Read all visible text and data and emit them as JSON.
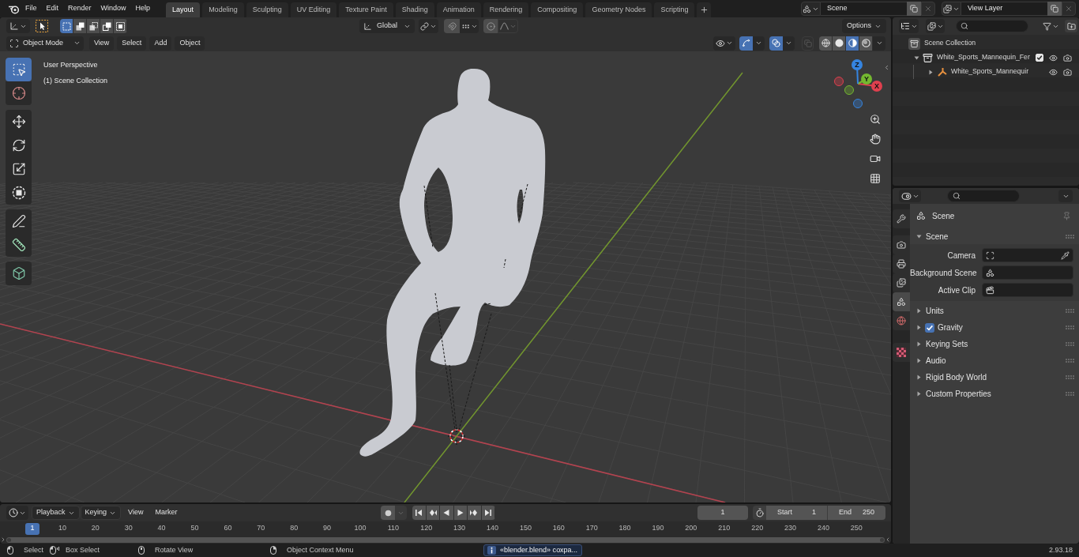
{
  "top_bar": {
    "menus": [
      "File",
      "Edit",
      "Render",
      "Window",
      "Help"
    ],
    "workspaces": [
      {
        "label": "Layout",
        "selected": true
      },
      {
        "label": "Modeling",
        "selected": false
      },
      {
        "label": "Sculpting",
        "selected": false
      },
      {
        "label": "UV Editing",
        "selected": false
      },
      {
        "label": "Texture Paint",
        "selected": false
      },
      {
        "label": "Shading",
        "selected": false
      },
      {
        "label": "Animation",
        "selected": false
      },
      {
        "label": "Rendering",
        "selected": false
      },
      {
        "label": "Compositing",
        "selected": false
      },
      {
        "label": "Geometry Nodes",
        "selected": false
      },
      {
        "label": "Scripting",
        "selected": false
      }
    ],
    "scene": "Scene",
    "view_layer": "View Layer"
  },
  "viewport": {
    "tool_header": {
      "select_modes": [
        {
          "selected": true
        },
        {
          "selected": false
        },
        {
          "selected": false
        },
        {
          "selected": false
        },
        {
          "selected": false
        }
      ],
      "orientation": "Global",
      "options": "Options"
    },
    "header": {
      "mode": "Object Mode",
      "menus": [
        "View",
        "Select",
        "Add",
        "Object"
      ],
      "gizmos": true,
      "overlays": true,
      "xray": false,
      "shading": [
        {
          "kind": "wireframe",
          "selected": false
        },
        {
          "kind": "solid",
          "selected": false
        },
        {
          "kind": "material",
          "selected": true
        },
        {
          "kind": "rendered",
          "selected": false
        }
      ]
    },
    "tools": [
      {
        "kind": "select_box",
        "selected": true
      },
      {
        "kind": "cursor",
        "selected": false
      },
      {
        "kind": "move",
        "selected": false
      },
      {
        "kind": "rotate",
        "selected": false
      },
      {
        "kind": "scale",
        "selected": false
      },
      {
        "kind": "transform",
        "selected": false
      },
      {
        "kind": "annotate",
        "selected": false
      },
      {
        "kind": "measure",
        "selected": false
      },
      {
        "kind": "add_cube",
        "selected": false
      }
    ],
    "overlay_text": [
      "User Perspective",
      "(1) Scene Collection"
    ],
    "gizmo": {
      "axes": [
        {
          "label": "X",
          "color": "#e0404e"
        },
        {
          "label": "Y",
          "color": "#74b830"
        },
        {
          "label": "Z",
          "color": "#3584e0"
        }
      ]
    }
  },
  "timeline": {
    "menus": [
      {
        "label": "Playback",
        "kind": "dropdown"
      },
      {
        "label": "Keying",
        "kind": "dropdown"
      },
      {
        "label": "View",
        "kind": "menu"
      },
      {
        "label": "Marker",
        "kind": "menu"
      }
    ],
    "auto_keying": false,
    "current_frame": "1",
    "start": {
      "label": "Start",
      "value": "1"
    },
    "end": {
      "label": "End",
      "value": "250"
    },
    "playhead": "1",
    "ruler": [
      "10",
      "20",
      "30",
      "40",
      "50",
      "60",
      "70",
      "80",
      "90",
      "100",
      "110",
      "120",
      "130",
      "140",
      "150",
      "160",
      "170",
      "180",
      "190",
      "200",
      "210",
      "220",
      "230",
      "240",
      "250"
    ]
  },
  "outliner": {
    "items": [
      {
        "label": "Scene Collection",
        "kind": "scene_collection",
        "children": [
          {
            "label": "White_Sports_Mannequin_Fer",
            "kind": "collection",
            "expanded": true,
            "checked": true,
            "children": [
              {
                "label": "White_Sports_Mannequir",
                "kind": "armature",
                "expanded": false
              }
            ]
          }
        ]
      }
    ]
  },
  "properties": {
    "tabs": [
      {
        "kind": "tool",
        "selected": false
      },
      {
        "kind": "render",
        "selected": false
      },
      {
        "kind": "output",
        "selected": false
      },
      {
        "kind": "view_layer",
        "selected": false
      },
      {
        "kind": "scene",
        "selected": true
      },
      {
        "kind": "world",
        "selected": false
      },
      {
        "kind": "texture",
        "selected": false
      }
    ],
    "context": "Scene",
    "panels": [
      {
        "label": "Scene",
        "expanded": true,
        "fields": [
          {
            "label": "Camera",
            "kind": "object"
          },
          {
            "label": "Background Scene",
            "kind": "scene"
          },
          {
            "label": "Active Clip",
            "kind": "clip"
          }
        ]
      },
      {
        "label": "Units",
        "expanded": false
      },
      {
        "label": "Gravity",
        "expanded": false,
        "toggle": {
          "checked": true
        }
      },
      {
        "label": "Keying Sets",
        "expanded": false
      },
      {
        "label": "Audio",
        "expanded": false
      },
      {
        "label": "Rigid Body World",
        "expanded": false
      },
      {
        "label": "Custom Properties",
        "expanded": false
      }
    ]
  },
  "status_bar": {
    "hints": [
      {
        "kind": "left_click",
        "label": "Select"
      },
      {
        "kind": "drag",
        "label": "Box Select"
      },
      {
        "kind": "middle_click",
        "label": "Rotate View"
      },
      {
        "kind": "right_click",
        "label": "Object Context Menu"
      }
    ],
    "report": "«blender.blend» сохра...",
    "version": "2.93.18"
  }
}
